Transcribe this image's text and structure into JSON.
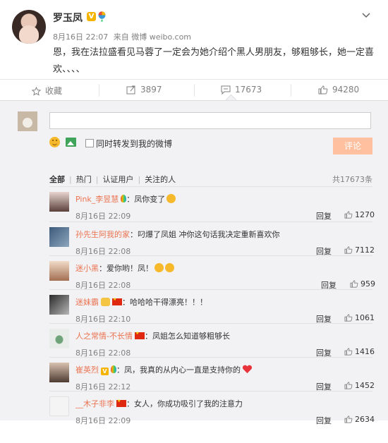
{
  "post": {
    "username": "罗玉凤",
    "v_badge": "V",
    "time": "8月16日 22:07",
    "source": "来自 微博 weibo.com",
    "content": "恩，我在法拉盛看见马蓉了一定会为她介绍个黑人男朋友，够粗够长，她一定喜欢、、、、"
  },
  "actions": {
    "favorite": "收藏",
    "repost": "3897",
    "comment": "17673",
    "like": "94280"
  },
  "composer": {
    "value": "",
    "repost_checkbox_label": "同时转发到我的微博",
    "submit_label": "评论"
  },
  "filter": {
    "tabs": [
      "全部",
      "热门",
      "认证用户",
      "关注的人"
    ],
    "total": "共17673条"
  },
  "reply_label": "回复",
  "comments": [
    {
      "user": "Pink_李昱慧",
      "text": "：凤你变了",
      "time": "8月16日 22:09",
      "likes": "1270"
    },
    {
      "user": "孙先生阿我的家",
      "text": "：叼爆了凤姐 冲你这句话我决定重新喜欢你",
      "time": "8月16日 22:08",
      "likes": "7112"
    },
    {
      "user": "迷小黑",
      "text": "：爱你哟！凤！",
      "time": "8月16日 22:08",
      "likes": "959"
    },
    {
      "user": "迷妹霸",
      "text": "：哈哈哈干得漂亮！！！",
      "time": "8月16日 22:10",
      "likes": "1061"
    },
    {
      "user": "人之常情-不长情",
      "text": "：凤姐怎么知道够粗够长",
      "time": "8月16日 22:08",
      "likes": "1416"
    },
    {
      "user": "崔英烈",
      "text": "：凤，我真的从内心一直是支持你的",
      "time": "8月16日 22:12",
      "likes": "1452"
    },
    {
      "user": "__木子非李",
      "text": "：女人，你成功吸引了我的注意力",
      "time": "8月16日 22:09",
      "likes": "2634"
    }
  ],
  "colors": {
    "accent": "#eb7350",
    "submit_bg": "#ffc09f",
    "panel_bg": "#f2f2f5"
  }
}
